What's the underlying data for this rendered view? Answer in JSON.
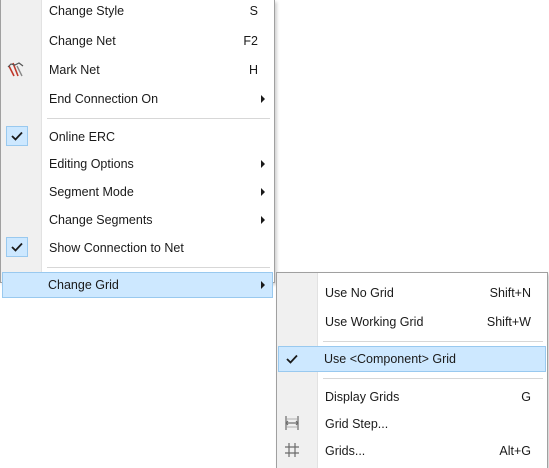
{
  "main_menu": {
    "items": [
      {
        "label": "Change Style",
        "shortcut": "S"
      },
      {
        "label": "Change Net",
        "shortcut": "F2"
      },
      {
        "label": "Mark Net",
        "shortcut": "H",
        "icon": "mark-net-icon"
      },
      {
        "label": "End Connection On",
        "submenu": true
      },
      {
        "label": "Online ERC",
        "checked": true
      },
      {
        "label": "Editing Options",
        "submenu": true
      },
      {
        "label": "Segment Mode",
        "submenu": true
      },
      {
        "label": "Change Segments",
        "submenu": true
      },
      {
        "label": "Show Connection to Net",
        "checked": true
      },
      {
        "label": "Change Grid",
        "submenu": true,
        "highlighted": true
      }
    ]
  },
  "sub_menu": {
    "items": [
      {
        "label": "Use No Grid",
        "shortcut": "Shift+N"
      },
      {
        "label": "Use Working Grid",
        "shortcut": "Shift+W"
      },
      {
        "label": "Use <Component> Grid",
        "checked": true,
        "highlighted": true
      },
      {
        "label": "Display Grids",
        "shortcut": "G"
      },
      {
        "label": "Grid Step...",
        "icon": "grid-step-icon"
      },
      {
        "label": "Grids...",
        "shortcut": "Alt+G",
        "icon": "grids-icon"
      }
    ]
  },
  "colors": {
    "highlight_bg": "#cde8ff",
    "highlight_border": "#99c9ef",
    "gutter": "#f0f0f0",
    "mark_net_icon": "#c0392b"
  }
}
